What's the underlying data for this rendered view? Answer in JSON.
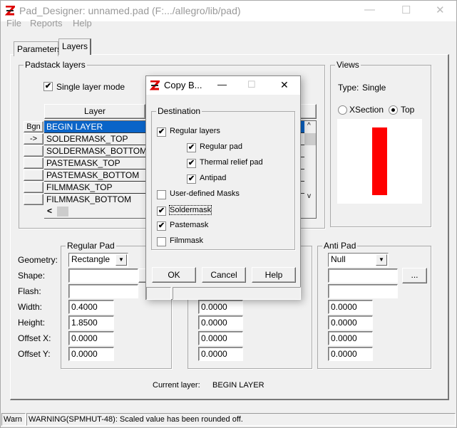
{
  "window": {
    "title": "Pad_Designer: unnamed.pad (F:.../allegro/lib/pad)",
    "minimize": "—",
    "maximize": "☐",
    "close": "✕"
  },
  "menu": [
    "File",
    "Reports",
    "Help"
  ],
  "tabs": [
    {
      "label": "Parameters",
      "selected": false
    },
    {
      "label": "Layers",
      "selected": true
    }
  ],
  "padstack": {
    "group_label": "Padstack layers",
    "single_layer_mode": {
      "label": "Single layer mode",
      "checked": true
    },
    "column_header": "Layer",
    "row_buttons": [
      "Bgn",
      "->",
      "",
      "",
      "",
      "",
      ""
    ],
    "layers": [
      "BEGIN LAYER",
      "SOLDERMASK_TOP",
      "SOLDERMASK_BOTTOM",
      "PASTEMASK_TOP",
      "PASTEMASK_BOTTOM",
      "FILMMASK_TOP",
      "FILMMASK_BOTTOM"
    ],
    "selected_index": 0,
    "scroll_left": "<",
    "scroll_up": "^",
    "scroll_down": "v"
  },
  "views": {
    "group_label": "Views",
    "type_label": "Type:",
    "type_value": "Single",
    "xsection_label": "XSection",
    "top_label": "Top",
    "selected_view": "Top",
    "pad_color": "#ff0000"
  },
  "regular_pad": {
    "group_label": "Regular Pad",
    "geometry": "Rectangle",
    "shape": "",
    "flash": "",
    "width": "0.4000",
    "height": "1.8500",
    "offset_x": "0.0000",
    "offset_y": "0.0000"
  },
  "field_labels": {
    "geometry": "Geometry:",
    "shape": "Shape:",
    "flash": "Flash:",
    "width": "Width:",
    "height": "Height:",
    "offset_x": "Offset X:",
    "offset_y": "Offset Y:"
  },
  "thermal_pad": {
    "width": "0.0000",
    "height": "0.0000",
    "offset_x": "0.0000",
    "offset_y": "0.0000"
  },
  "anti_pad": {
    "group_label": "Anti Pad",
    "geometry": "Null",
    "shape": "",
    "flash": "",
    "browse": "...",
    "width": "0.0000",
    "height": "0.0000",
    "offset_x": "0.0000",
    "offset_y": "0.0000"
  },
  "current_layer": {
    "label": "Current layer:",
    "value": "BEGIN LAYER"
  },
  "status": {
    "level": "Warn",
    "message": "WARNING(SPMHUT-48): Scaled value has been rounded off."
  },
  "dialog": {
    "title": "Copy B...",
    "minimize": "—",
    "maximize": "☐",
    "close": "✕",
    "group_label": "Destination",
    "options": [
      {
        "label": "Regular layers",
        "checked": true,
        "indent": false
      },
      {
        "label": "Regular pad",
        "checked": true,
        "indent": true
      },
      {
        "label": "Thermal relief pad",
        "checked": true,
        "indent": true
      },
      {
        "label": "Antipad",
        "checked": true,
        "indent": true
      },
      {
        "label": "User-defined Masks",
        "checked": false,
        "indent": false
      },
      {
        "label": "Soldermask",
        "checked": true,
        "indent": false
      },
      {
        "label": "Pastemask",
        "checked": true,
        "indent": false
      },
      {
        "label": "Filmmask",
        "checked": false,
        "indent": false
      }
    ],
    "ok": "OK",
    "cancel": "Cancel",
    "help": "Help"
  }
}
